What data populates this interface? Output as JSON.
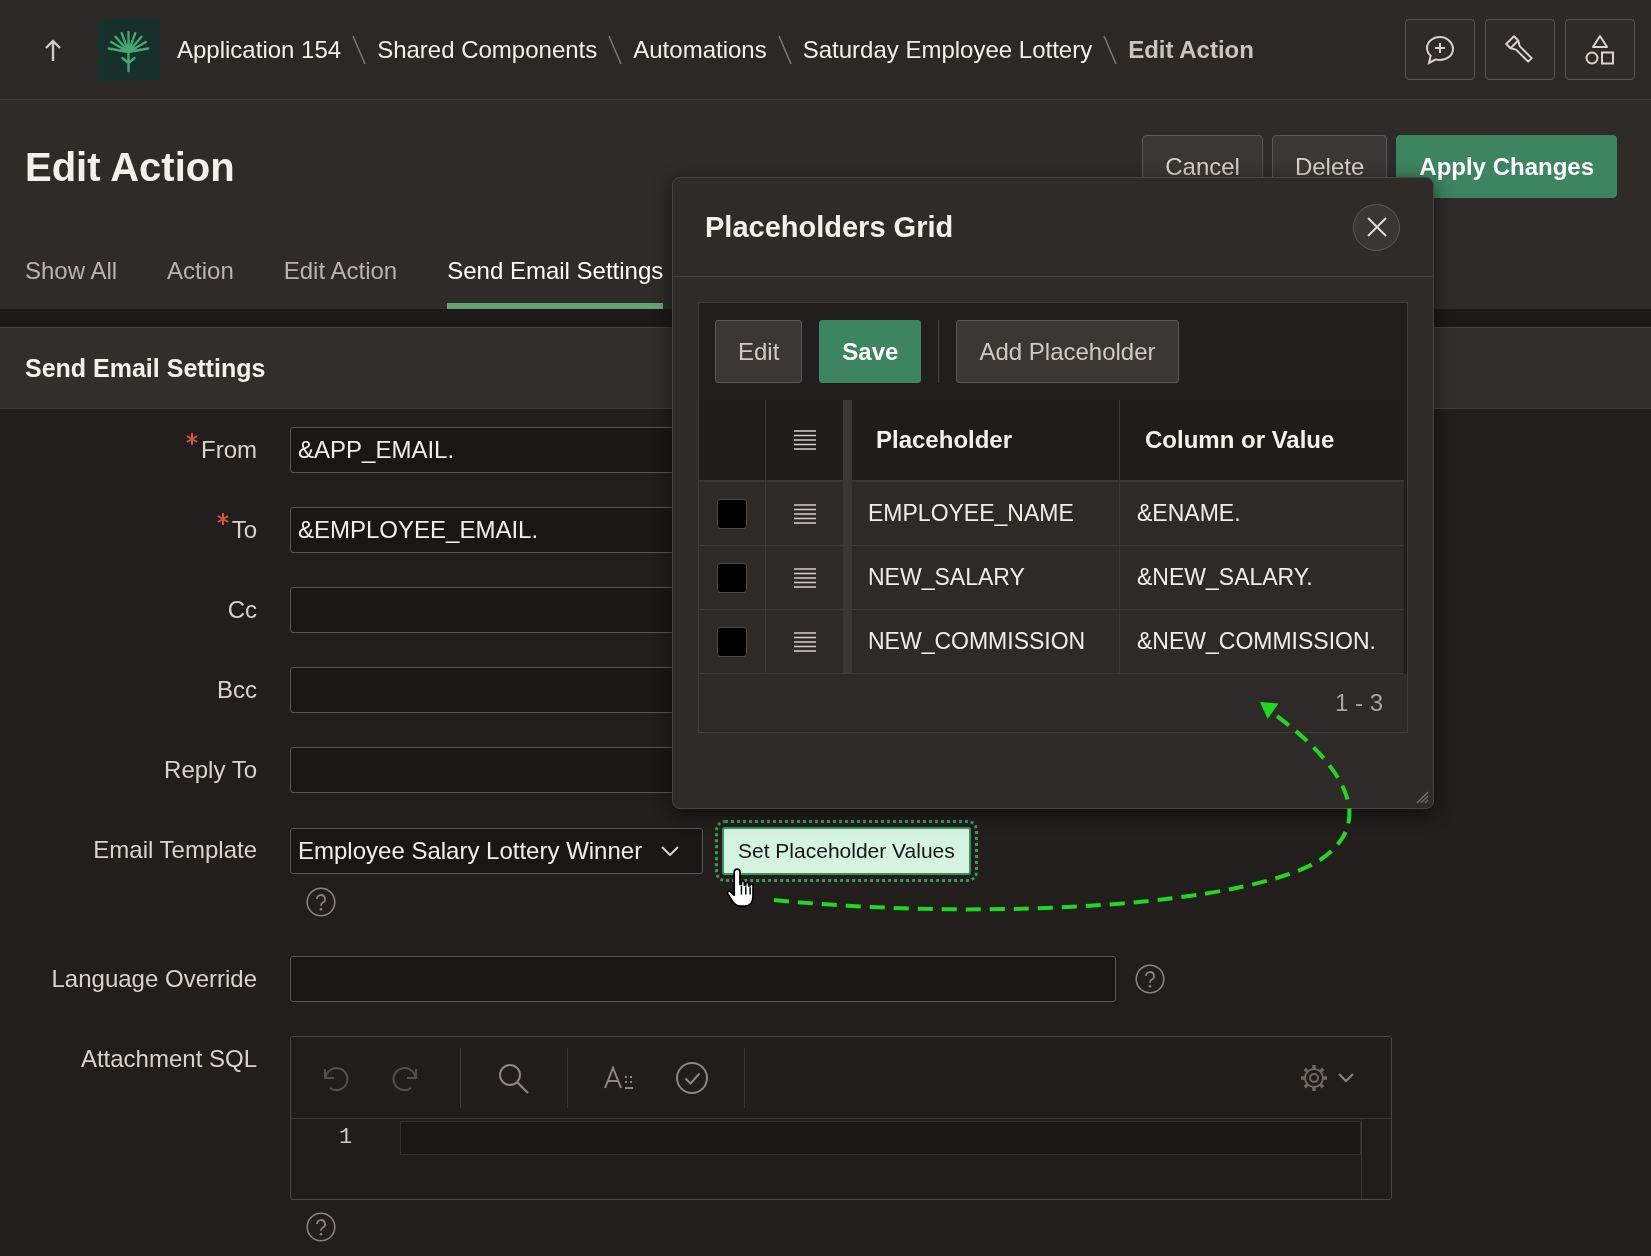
{
  "top_bar": {
    "breadcrumbs": [
      {
        "label": "Application 154",
        "current": false
      },
      {
        "label": "Shared Components",
        "current": false
      },
      {
        "label": "Automations",
        "current": false
      },
      {
        "label": "Saturday Employee Lottery",
        "current": false
      },
      {
        "label": "Edit Action",
        "current": true
      }
    ]
  },
  "page_header": {
    "title": "Edit Action",
    "buttons": [
      {
        "label": "Cancel",
        "kind": "default"
      },
      {
        "label": "Delete",
        "kind": "default"
      },
      {
        "label": "Apply Changes",
        "kind": "primary"
      }
    ]
  },
  "tabs": [
    {
      "label": "Show All",
      "selected": false
    },
    {
      "label": "Action",
      "selected": false
    },
    {
      "label": "Edit Action",
      "selected": false
    },
    {
      "label": "Send Email Settings",
      "selected": true
    }
  ],
  "region": {
    "title": "Send Email Settings",
    "fields": [
      {
        "kind": "text",
        "label": "From",
        "required": true,
        "value": "&APP_EMAIL."
      },
      {
        "kind": "text",
        "label": "To",
        "required": true,
        "value": "&EMPLOYEE_EMAIL."
      },
      {
        "kind": "text",
        "label": "Cc",
        "required": false
      },
      {
        "kind": "text",
        "label": "Bcc",
        "required": false
      },
      {
        "kind": "text",
        "label": "Reply To",
        "required": false
      },
      {
        "kind": "select",
        "label": "Email Template",
        "required": false,
        "value": "Employee Salary Lottery Winner",
        "help": true,
        "button": {
          "label": "Set Placeholder Values",
          "focused": true
        }
      },
      {
        "kind": "text",
        "label": "Language Override",
        "required": false,
        "help": true
      },
      {
        "kind": "code",
        "label": "Attachment SQL",
        "required": false,
        "help": true,
        "line_numbers": [
          "1"
        ],
        "undo_disabled": true,
        "redo_disabled": true
      }
    ]
  },
  "dialog": {
    "title": "Placeholders Grid",
    "toolbar": {
      "groups": [
        {
          "buttons": [
            {
              "label": "Edit",
              "kind": "default"
            },
            {
              "label": "Save",
              "kind": "primary"
            }
          ]
        },
        {
          "buttons": [
            {
              "label": "Add Placeholder",
              "kind": "default"
            }
          ]
        }
      ]
    },
    "grid": {
      "columns": [
        "Placeholder",
        "Column or Value"
      ],
      "rows": [
        {
          "checked": false,
          "placeholder": "EMPLOYEE_NAME",
          "column_or_value": "&ENAME."
        },
        {
          "checked": false,
          "placeholder": "NEW_SALARY",
          "column_or_value": "&NEW_SALARY."
        },
        {
          "checked": false,
          "placeholder": "NEW_COMMISSION",
          "column_or_value": "&NEW_COMMISSION."
        }
      ],
      "pagination": "1 - 3"
    }
  }
}
